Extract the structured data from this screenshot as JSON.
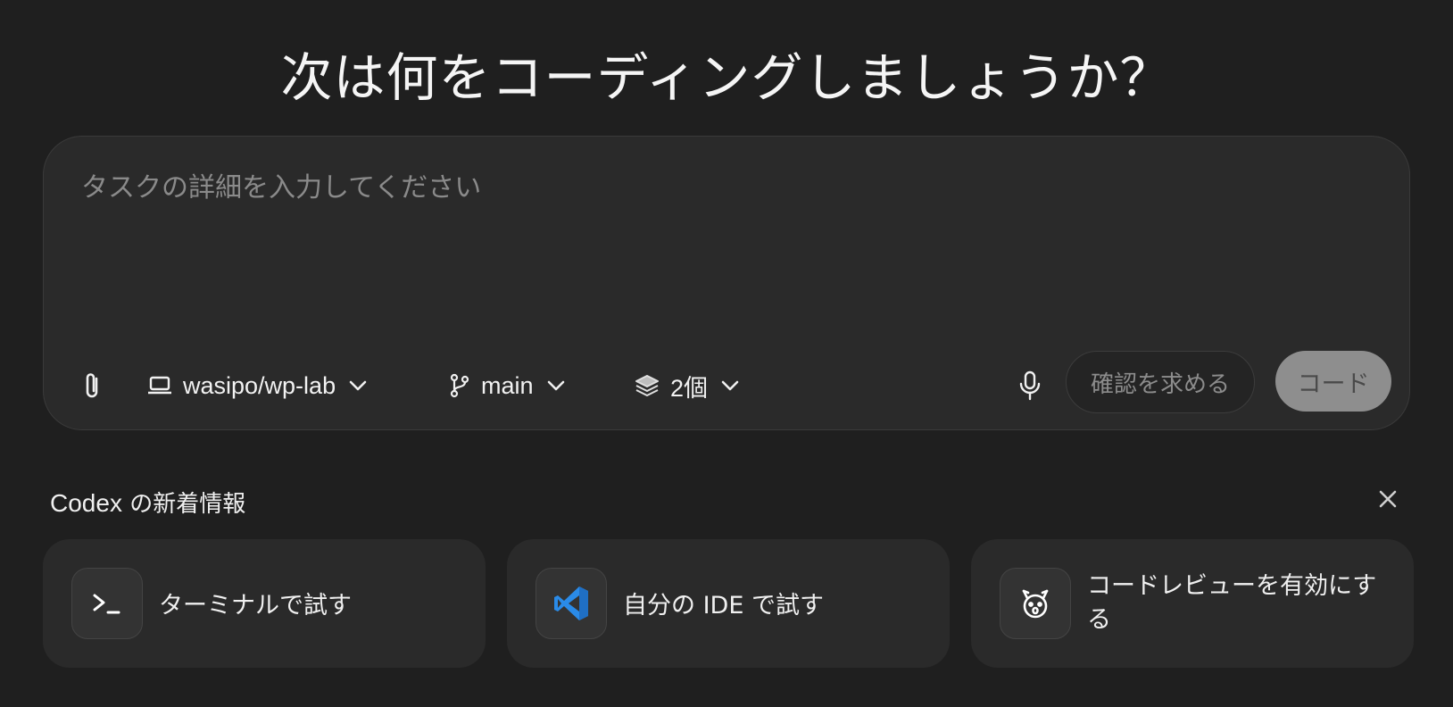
{
  "headline": "次は何をコーディングしましょうか？",
  "composer": {
    "placeholder": "タスクの詳細を入力してください",
    "value": ""
  },
  "toolbar": {
    "attach_icon": "paperclip-icon",
    "environment": {
      "label": "wasipo/wp-lab",
      "icon": "laptop-icon"
    },
    "branch": {
      "label": "main",
      "icon": "git-branch-icon"
    },
    "versions": {
      "label": "2個",
      "icon": "layers-icon"
    },
    "mic_icon": "microphone-icon",
    "ask_label": "確認を求める",
    "code_label": "コード"
  },
  "news": {
    "brand": "Codex",
    "title_suffix": " の新着情報",
    "cards": [
      {
        "label": "ターミナルで試す",
        "icon": "terminal-icon"
      },
      {
        "label": "自分の IDE で試す",
        "icon": "vscode-icon"
      },
      {
        "label": "コードレビューを有効にする",
        "icon": "review-bot-icon"
      }
    ]
  },
  "colors": {
    "background": "#1f1f1f",
    "panel": "#2a2a2a",
    "code_button": "#8e8e8e",
    "vscode_blue": "#2a8be8"
  }
}
